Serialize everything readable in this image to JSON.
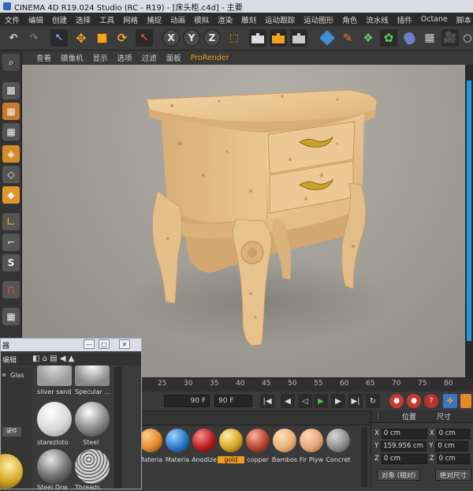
{
  "window": {
    "title": "CINEMA 4D R19.024 Studio (RC - R19) - [床头柜.c4d] - 主要"
  },
  "menu": [
    "文件",
    "编辑",
    "创建",
    "选择",
    "工具",
    "网格",
    "捕捉",
    "动画",
    "模拟",
    "渲染",
    "雕刻",
    "运动跟踪",
    "运动图形",
    "角色",
    "流水线",
    "插件",
    "Octane",
    "脚本",
    "窗口",
    "帮助"
  ],
  "viewport_menu": [
    "查看",
    "摄像机",
    "显示",
    "选项",
    "过滤",
    "面板",
    "ProRender"
  ],
  "toolbar": {
    "axis_x": "X",
    "axis_y": "Y",
    "axis_z": "Z"
  },
  "timeline": {
    "ticks": [
      "25",
      "30",
      "35",
      "40",
      "45",
      "50",
      "55",
      "60",
      "65",
      "70",
      "75",
      "80"
    ],
    "start_frame": "90 F",
    "end_frame": "90 F"
  },
  "materials": [
    {
      "label": "Materia",
      "color": "#e38a2a"
    },
    {
      "label": "Materia",
      "color": "#2a78c8"
    },
    {
      "label": "Anodize",
      "color": "#b51c1c"
    },
    {
      "label": "gold",
      "color": "#d4a623"
    },
    {
      "label": "copper",
      "color": "#b2452e"
    },
    {
      "label": "Bambos",
      "color": "#e7b07a"
    },
    {
      "label": "Fir Plyw",
      "color": "#e2a77a"
    },
    {
      "label": "Concret",
      "color": "#8c8c8c"
    }
  ],
  "coords": {
    "header_pos": "位置",
    "header_size": "尺寸",
    "rows": [
      {
        "axis": "X",
        "pos": "0 cm",
        "size_axis": "X",
        "size": "0 cm"
      },
      {
        "axis": "Y",
        "pos": "159.956 cm",
        "size_axis": "Y",
        "size": "0 cm"
      },
      {
        "axis": "Z",
        "pos": "0 cm",
        "size_axis": "Z",
        "size": "0 cm"
      }
    ],
    "mode_button": "对象 (相对)",
    "size_button": "绝对尺寸"
  },
  "float_window": {
    "title": "器",
    "left_labels": [
      "编辑",
      "Glas",
      "硬件"
    ],
    "thumbs": [
      {
        "label": "sliver sand"
      },
      {
        "label": "Specular ..."
      },
      {
        "label": "starezloto"
      },
      {
        "label": "Steel"
      },
      {
        "label": "Steel Drw"
      },
      {
        "label": "Threads"
      }
    ]
  }
}
